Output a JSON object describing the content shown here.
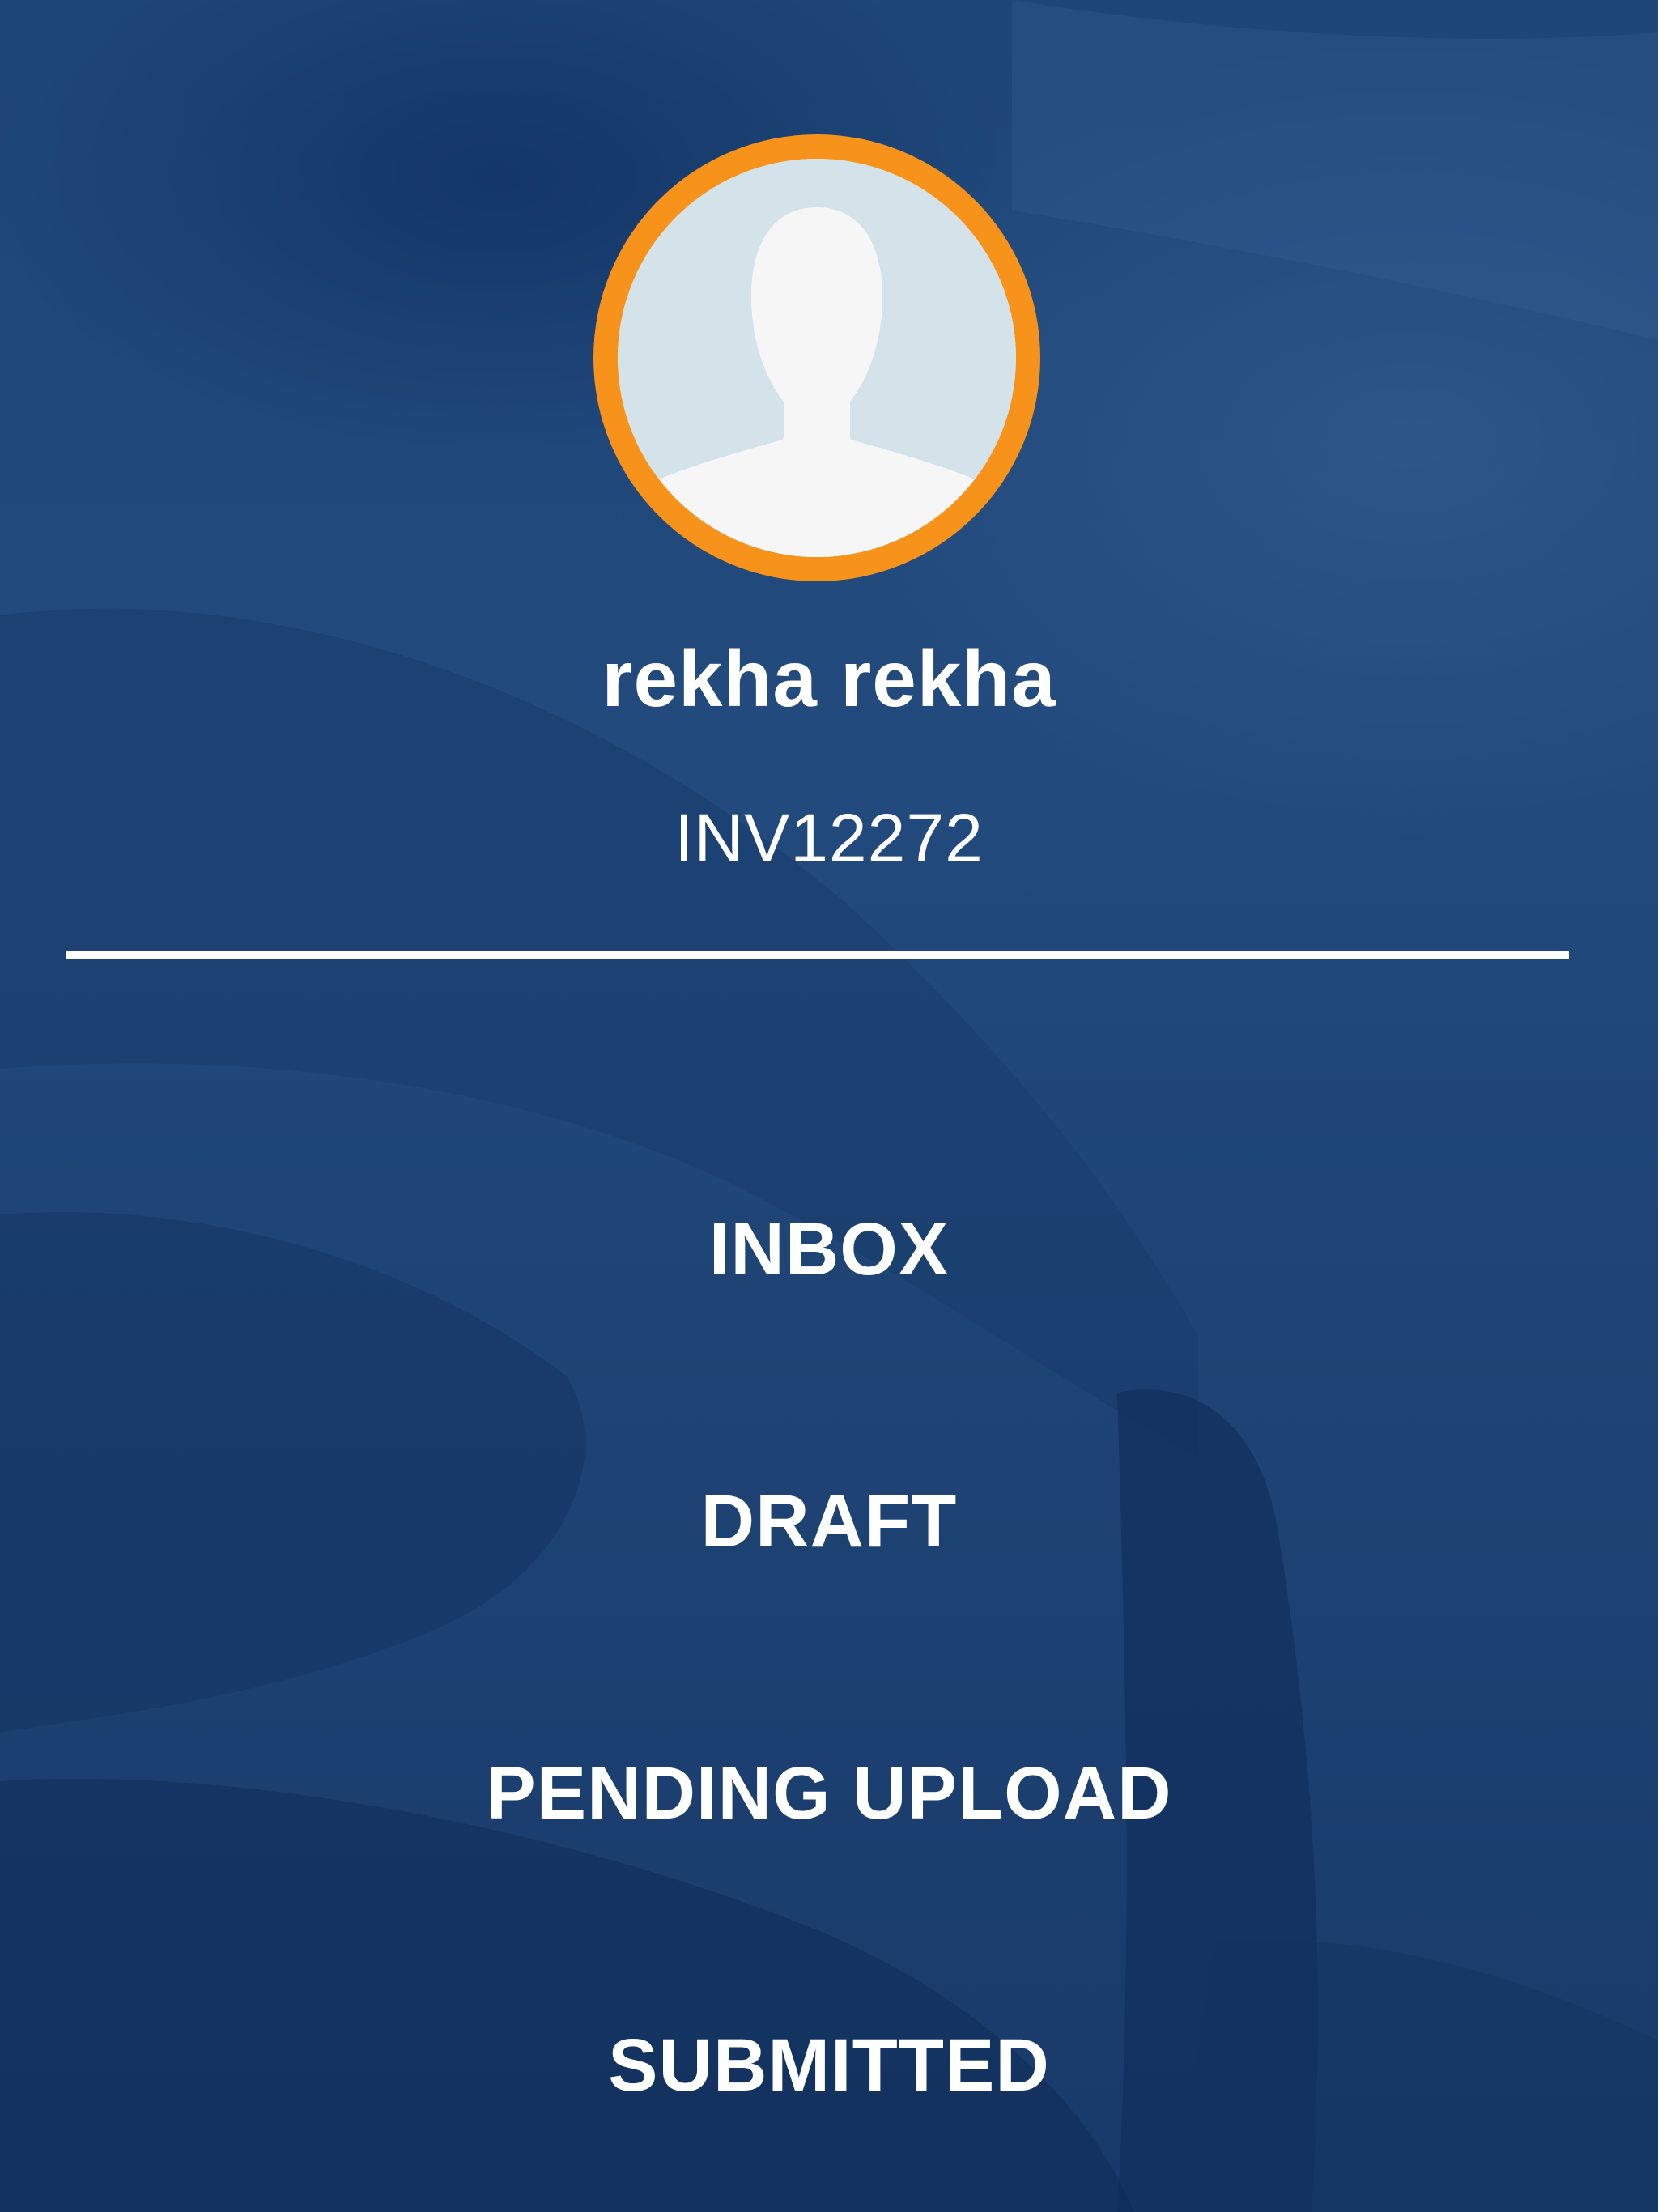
{
  "profile": {
    "avatar_icon": "user-silhouette-icon",
    "name": "rekha rekha",
    "id": "INV12272"
  },
  "menu": {
    "items": [
      {
        "label": "INBOX"
      },
      {
        "label": "DRAFT"
      },
      {
        "label": "PENDING UPLOAD"
      },
      {
        "label": "SUBMITTED"
      }
    ]
  },
  "colors": {
    "background": "#21477a",
    "avatar_ring": "#f7931a",
    "text": "#ffffff"
  }
}
